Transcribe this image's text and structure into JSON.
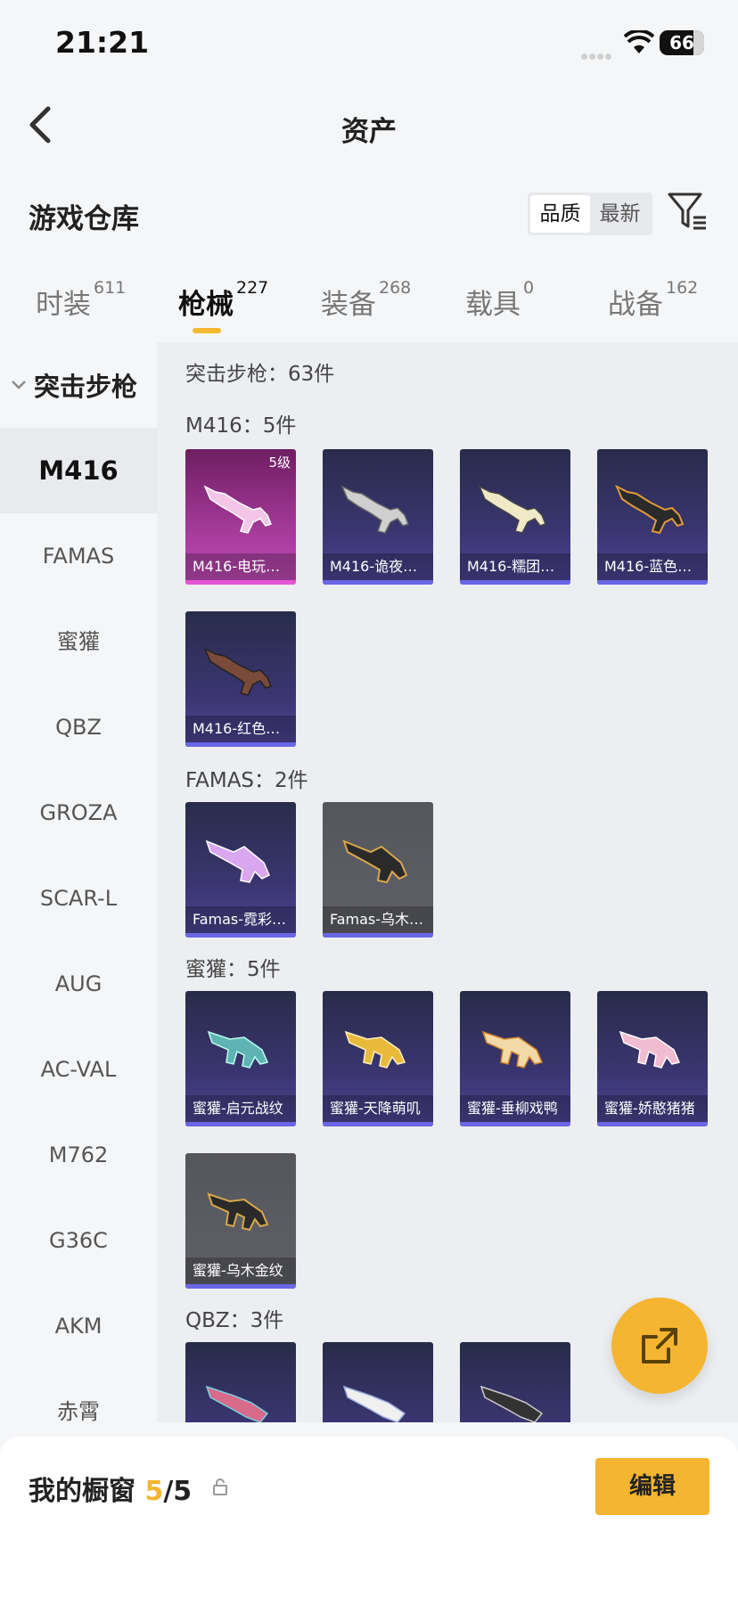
{
  "status": {
    "time": "21:21",
    "battery": "66"
  },
  "nav": {
    "title": "资产"
  },
  "section": {
    "title": "游戏仓库",
    "sort_options": [
      "品质",
      "最新"
    ],
    "sort_selected": "品质"
  },
  "tabs": [
    {
      "label": "时装",
      "count": "611"
    },
    {
      "label": "枪械",
      "count": "227",
      "active": true
    },
    {
      "label": "装备",
      "count": "268"
    },
    {
      "label": "载具",
      "count": "0"
    },
    {
      "label": "战备",
      "count": "162"
    }
  ],
  "sidebar": {
    "group": "突击步枪",
    "items": [
      "M416",
      "FAMAS",
      "蜜獾",
      "QBZ",
      "GROZA",
      "SCAR-L",
      "AUG",
      "AC-VAL",
      "M762",
      "G36C",
      "AKM",
      "赤霄"
    ],
    "active": "M416"
  },
  "main": {
    "summary": "突击步枪：63件",
    "groups": [
      {
        "header": "M416：5件",
        "items": [
          {
            "name": "M416-电玩…",
            "style": "pink",
            "level": "5级"
          },
          {
            "name": "M416-诡夜…",
            "style": "purple"
          },
          {
            "name": "M416-糯团…",
            "style": "purple"
          },
          {
            "name": "M416-蓝色…",
            "style": "purple"
          },
          {
            "name": "M416-红色…",
            "style": "purple"
          }
        ]
      },
      {
        "header": "FAMAS：2件",
        "items": [
          {
            "name": "Famas-霓彩…",
            "style": "purple"
          },
          {
            "name": "Famas-乌木…",
            "style": "gray"
          }
        ]
      },
      {
        "header": "蜜獾：5件",
        "items": [
          {
            "name": "蜜獾-启元战纹",
            "style": "purple"
          },
          {
            "name": "蜜獾-天降萌叽",
            "style": "purple"
          },
          {
            "name": "蜜獾-垂柳戏鸭",
            "style": "purple"
          },
          {
            "name": "蜜獾-娇憨猪猪",
            "style": "purple"
          },
          {
            "name": "蜜獾-乌木金纹",
            "style": "gray"
          }
        ]
      },
      {
        "header": "QBZ：3件",
        "items": [
          {
            "name": "",
            "style": "purple"
          },
          {
            "name": "",
            "style": "purple"
          },
          {
            "name": "",
            "style": "purple"
          }
        ]
      }
    ]
  },
  "bottom": {
    "label": "我的橱窗",
    "current": "5",
    "total": "/5",
    "edit": "编辑"
  },
  "colors": {
    "accent": "#f5b530",
    "card_purple": "#3a3570",
    "card_pink": "#a43a99",
    "card_gray": "#5a5b61"
  },
  "icons": [
    "back-arrow-icon",
    "filter-icon",
    "chevron-down-icon",
    "share-icon",
    "lock-icon",
    "wifi-icon"
  ]
}
